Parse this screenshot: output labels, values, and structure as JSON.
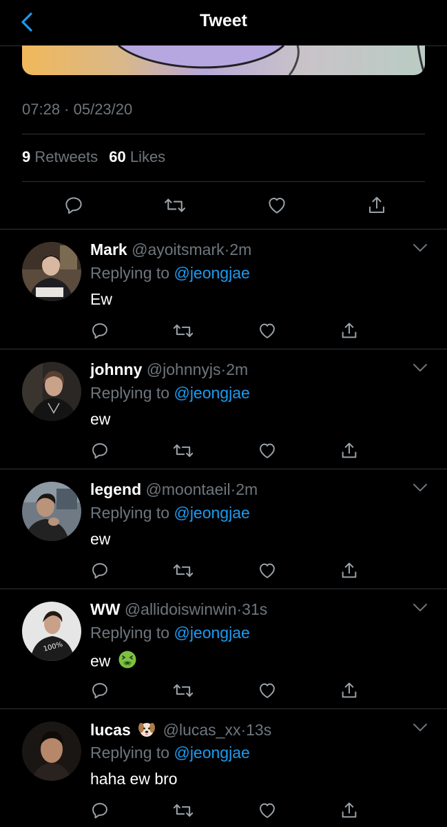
{
  "header": {
    "title": "Tweet",
    "back_icon": "chevron-left-icon"
  },
  "tweet": {
    "timestamp": "07:28 · 05/23/20",
    "retweets_count": "9",
    "retweets_label": "Retweets",
    "likes_count": "60",
    "likes_label": "Likes"
  },
  "colors": {
    "background": "#000000",
    "accent": "#1d9bf0",
    "muted": "#6e767d",
    "divider": "#2f3336"
  },
  "replies": [
    {
      "display_name": "Mark",
      "handle": "@ayoitsmark",
      "time": "2m",
      "replying_label": "Replying to",
      "mention": "@jeongjae",
      "text": "Ew"
    },
    {
      "display_name": "johnny",
      "handle": "@johnnyjs",
      "time": "2m",
      "replying_label": "Replying to",
      "mention": "@jeongjae",
      "text": "ew"
    },
    {
      "display_name": "legend",
      "handle": "@moontaeil",
      "time": "2m",
      "replying_label": "Replying to",
      "mention": "@jeongjae",
      "text": "ew"
    },
    {
      "display_name": "WW",
      "handle": "@allidoiswinwin",
      "time": "31s",
      "replying_label": "Replying to",
      "mention": "@jeongjae",
      "text": "ew",
      "emoji": "nauseated-face-emoji"
    },
    {
      "display_name": "lucas",
      "handle": "@lucas_xx",
      "time": "13s",
      "replying_label": "Replying to",
      "mention": "@jeongjae",
      "text": "haha ew bro",
      "name_emoji": "dog-face-emoji"
    }
  ]
}
